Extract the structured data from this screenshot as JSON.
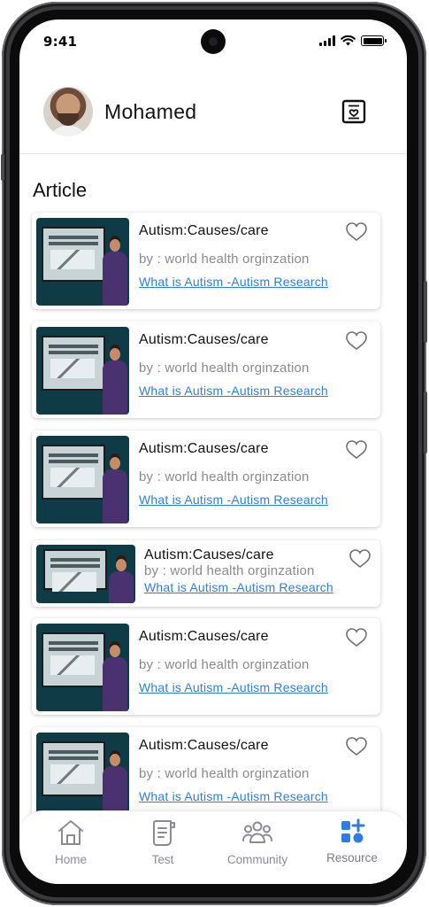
{
  "status_bar": {
    "time": "9:41"
  },
  "profile": {
    "name": "Mohamed"
  },
  "section": {
    "title": "Article"
  },
  "articles": [
    {
      "title": "Autism:Causes/care",
      "author": "by : world health orginzation",
      "link": "What is Autism -Autism Research"
    },
    {
      "title": "Autism:Causes/care",
      "author": "by : world health orginzation",
      "link": "What is Autism -Autism Research"
    },
    {
      "title": "Autism:Causes/care",
      "author": "by : world health orginzation",
      "link": "What is Autism -Autism Research"
    },
    {
      "title": "Autism:Causes/care",
      "author": "by : world health orginzation",
      "link": "What is Autism -Autism Research"
    },
    {
      "title": "Autism:Causes/care",
      "author": "by : world health orginzation",
      "link": "What is Autism -Autism Research"
    },
    {
      "title": "Autism:Causes/care",
      "author": "by : world health orginzation",
      "link": "What is Autism -Autism Research"
    }
  ],
  "bottom_nav": {
    "items": [
      {
        "label": "Home",
        "icon": "home-icon"
      },
      {
        "label": "Test",
        "icon": "test-document-icon"
      },
      {
        "label": "Community",
        "icon": "community-icon"
      },
      {
        "label": "Resource",
        "icon": "resource-grid-icon",
        "active": true
      }
    ]
  },
  "colors": {
    "link": "#2f7de1",
    "active_nav": "#2f7de1",
    "muted_text": "#8a8a8e"
  }
}
